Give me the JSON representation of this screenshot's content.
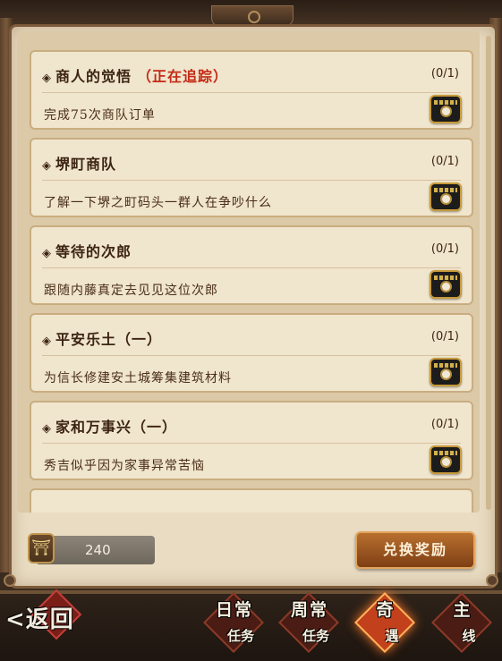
{
  "quests": [
    {
      "title": "商人的觉悟",
      "tracking": "（正在追踪）",
      "progress": "(0/1)",
      "description": "完成75次商队订单",
      "reward_icon": "treasure-chest-icon"
    },
    {
      "title": "堺町商队",
      "tracking": "",
      "progress": "(0/1)",
      "description": "了解一下堺之町码头一群人在争吵什么",
      "reward_icon": "treasure-chest-icon"
    },
    {
      "title": "等待的次郎",
      "tracking": "",
      "progress": "(0/1)",
      "description": "跟随内藤真定去见见这位次郎",
      "reward_icon": "treasure-chest-icon"
    },
    {
      "title": "平安乐土（一）",
      "tracking": "",
      "progress": "(0/1)",
      "description": "为信长修建安土城筹集建筑材料",
      "reward_icon": "treasure-chest-icon"
    },
    {
      "title": "家和万事兴（一）",
      "tracking": "",
      "progress": "(0/1)",
      "description": "秀吉似乎因为家事异常苦恼",
      "reward_icon": "treasure-chest-icon"
    }
  ],
  "currency": {
    "icon": "torii-gate-icon",
    "amount": "240"
  },
  "exchange_button": "兑换奖励",
  "nav": {
    "back": "<返回",
    "tabs": [
      {
        "label": "日常",
        "sublabel": "任务",
        "active": false
      },
      {
        "label": "周常",
        "sublabel": "任务",
        "active": false
      },
      {
        "label": "奇",
        "sublabel": "遇",
        "active": true
      },
      {
        "label": "主",
        "sublabel": "线",
        "active": false
      }
    ]
  },
  "colors": {
    "tracking": "#c42b16",
    "parchment": "#e9dcc2",
    "active_tab": "#c2401b"
  }
}
